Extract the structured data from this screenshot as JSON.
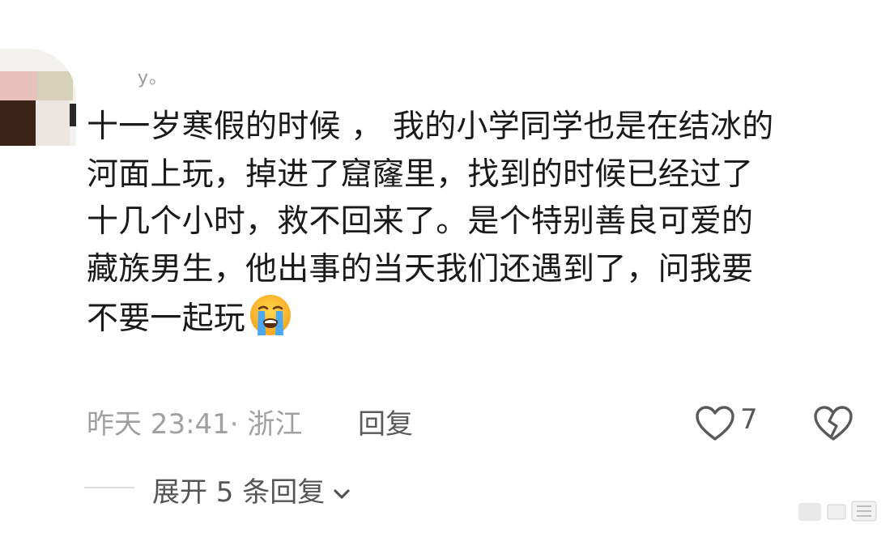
{
  "comment": {
    "username": "y。",
    "lines": [
      "十一岁寒假的时候 ， 我的小学同学也是在结冰的",
      "河面上玩，掉进了窟窿里，找到的时候已经过了",
      "十几个小时，救不回来了。是个特别善良可爱的",
      "藏族男生，他出事的当天我们还遇到了，问我要",
      "不要一起玩"
    ],
    "emoji": "loudly-crying-face",
    "time_location": "昨天 23:41· 浙江",
    "reply_label": "回复",
    "like_count": "7"
  },
  "expand_replies": {
    "label": "展开 5 条回复"
  },
  "icons": {
    "like": "heart-outline-icon",
    "dislike": "broken-heart-icon",
    "expand": "chevron-down-icon"
  },
  "colors": {
    "text": "#1a1a1a",
    "meta": "#a0a0a0",
    "action": "#5a5a5a"
  }
}
